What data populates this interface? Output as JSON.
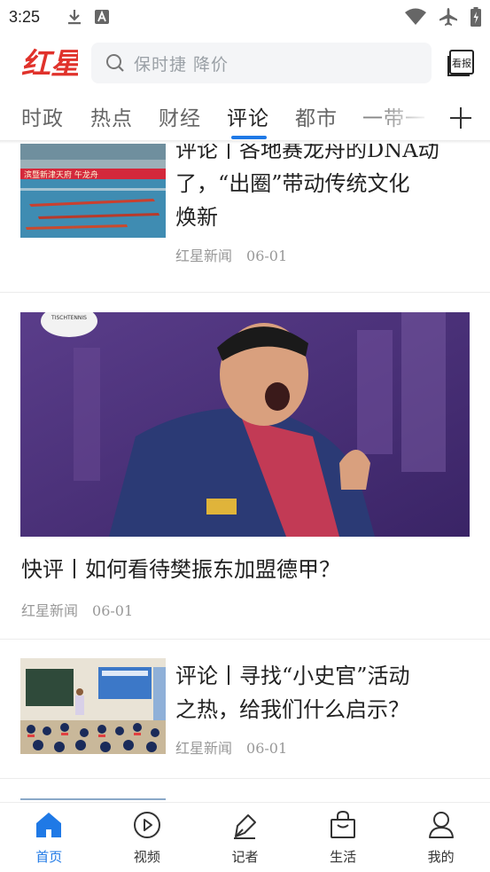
{
  "status_bar": {
    "time": "3:25",
    "left_icons": [
      "download-icon",
      "a-notification-icon"
    ],
    "right_icons": [
      "wifi-icon",
      "airplane-icon",
      "battery-icon"
    ]
  },
  "header": {
    "logo_text": "红星",
    "search_placeholder": "保时捷 降价",
    "paper_button_label": "看报"
  },
  "tabs": {
    "items": [
      "时政",
      "热点",
      "财经",
      "评论",
      "都市",
      "一带一"
    ],
    "active": "评论",
    "accent_color": "#1f79e6"
  },
  "articles": [
    {
      "title": "评论丨各地赛龙舟的DNA动了，“出圈”带动传统文化焕新",
      "title_lines": [
        "评论丨各地赛龙舟的DNA动",
        "了，“出圈”带动传统文化",
        "焕新"
      ],
      "source": "红星新闻",
      "date": "06-01",
      "banner_text": "滨暨新津天府  午龙舟"
    },
    {
      "title": "快评丨如何看待樊振东加盟德甲？",
      "source": "红星新闻",
      "date": "06-01",
      "logo_text": "TISCHTENNIS"
    },
    {
      "title": "评论丨寻找“小史官”活动之热，给我们什么启示？",
      "title_lines": [
        "评论丨寻找“小史官”活动",
        "之热，给我们什么启示？"
      ],
      "source": "红星新闻",
      "date": "06-01"
    }
  ],
  "bottom_nav": {
    "items": [
      {
        "label": "首页",
        "icon": "home-icon",
        "active": true
      },
      {
        "label": "视频",
        "icon": "play-circle-icon",
        "active": false
      },
      {
        "label": "记者",
        "icon": "pen-icon",
        "active": false
      },
      {
        "label": "生活",
        "icon": "shopping-bag-icon",
        "active": false
      },
      {
        "label": "我的",
        "icon": "user-icon",
        "active": false
      }
    ]
  },
  "colors": {
    "brand_red": "#e0322b",
    "accent_blue": "#1f79e6",
    "meta_gray": "#999999"
  }
}
